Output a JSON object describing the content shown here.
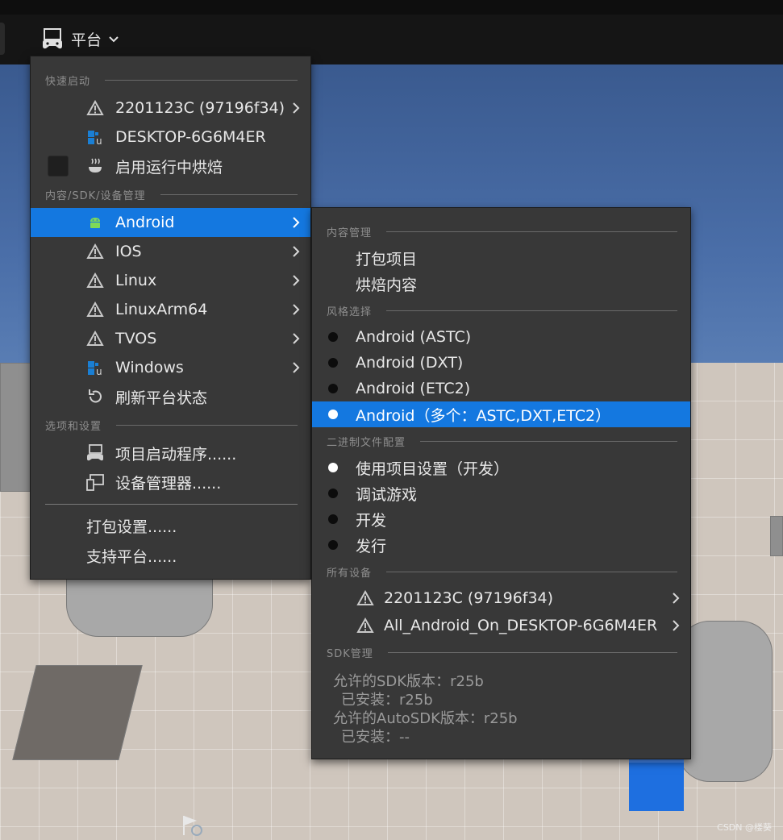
{
  "toolbar": {
    "platform_label": "平台",
    "platform_icon": "gamepad-monitor-icon"
  },
  "main_menu": {
    "quick_launch": {
      "header": "快速启动",
      "items": [
        {
          "label": "2201123C (97196f34)",
          "icon": "warning-icon",
          "submenu": true
        },
        {
          "label": "DESKTOP-6G6M4ER",
          "icon": "windows-unreal-icon",
          "submenu": false
        },
        {
          "label": "启用运行中烘焙",
          "icon": "steam-cook-icon",
          "submenu": false,
          "checkbox": false
        }
      ]
    },
    "content_sdk": {
      "header": "内容/SDK/设备管理",
      "items": [
        {
          "label": "Android",
          "icon": "android-icon",
          "submenu": true,
          "selected": true
        },
        {
          "label": "IOS",
          "icon": "warning-icon",
          "submenu": true
        },
        {
          "label": "Linux",
          "icon": "warning-icon",
          "submenu": true
        },
        {
          "label": "LinuxArm64",
          "icon": "warning-icon",
          "submenu": true
        },
        {
          "label": "TVOS",
          "icon": "warning-icon",
          "submenu": true
        },
        {
          "label": "Windows",
          "icon": "windows-unreal-icon",
          "submenu": true
        },
        {
          "label": "刷新平台状态",
          "icon": "refresh-icon",
          "submenu": false
        }
      ]
    },
    "options": {
      "header": "选项和设置",
      "items": [
        {
          "label": "项目启动程序......",
          "icon": "project-launcher-icon"
        },
        {
          "label": "设备管理器......",
          "icon": "device-manager-icon"
        }
      ]
    },
    "footer": {
      "items": [
        {
          "label": "打包设置......"
        },
        {
          "label": "支持平台......"
        }
      ]
    }
  },
  "android_submenu": {
    "content": {
      "header": "内容管理",
      "items": [
        "打包项目",
        "烘焙内容"
      ]
    },
    "flavor": {
      "header": "风格选择",
      "items": [
        {
          "label": "Android (ASTC)",
          "checked": false
        },
        {
          "label": "Android (DXT)",
          "checked": false
        },
        {
          "label": "Android (ETC2)",
          "checked": false
        },
        {
          "label": "Android（多个：ASTC,DXT,ETC2）",
          "checked": true,
          "selected": true
        }
      ]
    },
    "binary": {
      "header": "二进制文件配置",
      "items": [
        {
          "label": "使用项目设置（开发）",
          "checked": true
        },
        {
          "label": "调试游戏",
          "checked": false
        },
        {
          "label": "开发",
          "checked": false
        },
        {
          "label": "发行",
          "checked": false
        }
      ]
    },
    "devices": {
      "header": "所有设备",
      "items": [
        {
          "label": "2201123C (97196f34)",
          "icon": "warning-icon"
        },
        {
          "label": "All_Android_On_DESKTOP-6G6M4ER",
          "icon": "warning-icon"
        }
      ]
    },
    "sdk": {
      "header": "SDK管理",
      "lines": [
        "允许的SDK版本：r25b",
        "已安装：r25b",
        "允许的AutoSDK版本：r25b",
        "已安装：--"
      ]
    }
  },
  "watermark": "CSDN @楼葵",
  "colors": {
    "menu_bg": "#383838",
    "selection": "#1478e0",
    "toolbar_bg": "#151515"
  }
}
